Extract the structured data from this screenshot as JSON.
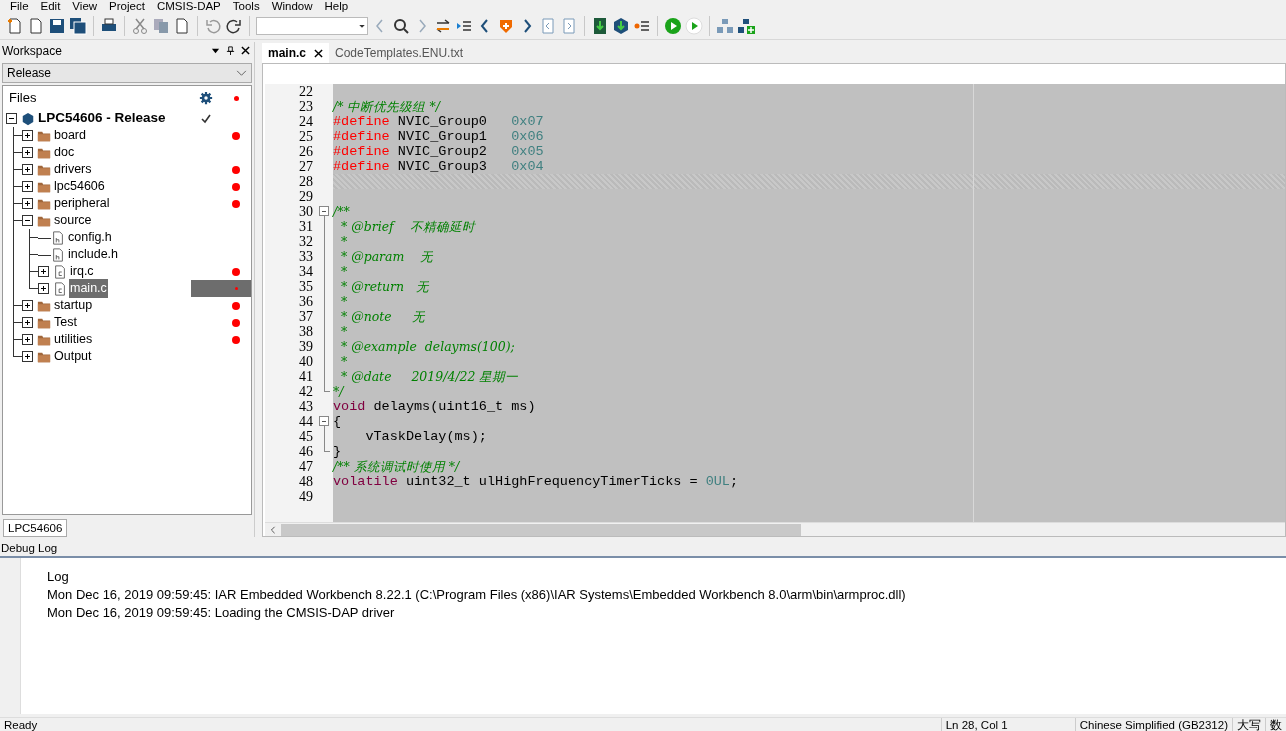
{
  "menu": [
    "File",
    "Edit",
    "View",
    "Project",
    "CMSIS-DAP",
    "Tools",
    "Window",
    "Help"
  ],
  "workspace": {
    "title": "Workspace",
    "configuration": "Release",
    "files_header": "Files",
    "tree": [
      {
        "label": "LPC54606 - Release",
        "kind": "project",
        "expanded": true,
        "checked": true,
        "error": false,
        "selected": false,
        "children": [
          {
            "label": "board",
            "kind": "folder",
            "expanded": false,
            "error": true,
            "selected": false
          },
          {
            "label": "doc",
            "kind": "folder",
            "expanded": false,
            "error": false,
            "selected": false
          },
          {
            "label": "drivers",
            "kind": "folder",
            "expanded": false,
            "error": true,
            "selected": false
          },
          {
            "label": "lpc54606",
            "kind": "folder",
            "expanded": false,
            "error": true,
            "selected": false
          },
          {
            "label": "peripheral",
            "kind": "folder",
            "expanded": false,
            "error": true,
            "selected": false
          },
          {
            "label": "source",
            "kind": "folder",
            "expanded": true,
            "error": false,
            "selected": false,
            "children": [
              {
                "label": "config.h",
                "kind": "header",
                "error": false,
                "selected": false
              },
              {
                "label": "include.h",
                "kind": "header",
                "error": false,
                "selected": false
              },
              {
                "label": "irq.c",
                "kind": "source",
                "expanded": false,
                "error": true,
                "selected": false
              },
              {
                "label": "main.c",
                "kind": "source",
                "expanded": false,
                "error": true,
                "selected": true
              }
            ]
          },
          {
            "label": "startup",
            "kind": "folder",
            "expanded": false,
            "error": true,
            "selected": false
          },
          {
            "label": "Test",
            "kind": "folder",
            "expanded": false,
            "error": true,
            "selected": false
          },
          {
            "label": "utilities",
            "kind": "folder",
            "expanded": false,
            "error": true,
            "selected": false
          },
          {
            "label": "Output",
            "kind": "folder",
            "expanded": false,
            "error": false,
            "selected": false
          }
        ]
      }
    ],
    "bottom_tab": "LPC54606"
  },
  "editor": {
    "tabs": [
      {
        "label": "main.c",
        "selected": true
      },
      {
        "label": "CodeTemplates.ENU.txt",
        "selected": false
      }
    ],
    "lines": [
      {
        "number": "22",
        "kind": "plain",
        "current": false
      },
      {
        "number": "23",
        "kind": "plain",
        "current": false,
        "tokens": [
          {
            "kind": "comment",
            "text": "/* 中断优先级组 */"
          }
        ]
      },
      {
        "number": "24",
        "kind": "plain",
        "current": false,
        "tokens": [
          {
            "kind": "directive",
            "text": "#define"
          },
          {
            "kind": "plain",
            "text": " NVIC_Group0   "
          },
          {
            "kind": "number",
            "text": "0x07"
          }
        ]
      },
      {
        "number": "25",
        "kind": "plain",
        "current": false,
        "tokens": [
          {
            "kind": "directive",
            "text": "#define"
          },
          {
            "kind": "plain",
            "text": " NVIC_Group1   "
          },
          {
            "kind": "number",
            "text": "0x06"
          }
        ]
      },
      {
        "number": "26",
        "kind": "plain",
        "current": false,
        "tokens": [
          {
            "kind": "directive",
            "text": "#define"
          },
          {
            "kind": "plain",
            "text": " NVIC_Group2   "
          },
          {
            "kind": "number",
            "text": "0x05"
          }
        ]
      },
      {
        "number": "27",
        "kind": "plain",
        "current": false,
        "tokens": [
          {
            "kind": "directive",
            "text": "#define"
          },
          {
            "kind": "plain",
            "text": " NVIC_Group3   "
          },
          {
            "kind": "number",
            "text": "0x04"
          }
        ]
      },
      {
        "number": "28",
        "kind": "plain",
        "current": true
      },
      {
        "number": "29",
        "kind": "plain",
        "current": false
      },
      {
        "number": "30",
        "kind": "foldstart",
        "current": false,
        "tokens": [
          {
            "kind": "comment",
            "text": "/**"
          }
        ]
      },
      {
        "number": "31",
        "kind": "foldbody",
        "current": false,
        "tokens": [
          {
            "kind": "comment",
            "text": "  * @brief    不精确延时"
          }
        ]
      },
      {
        "number": "32",
        "kind": "foldbody",
        "current": false,
        "tokens": [
          {
            "kind": "comment",
            "text": "  *"
          }
        ]
      },
      {
        "number": "33",
        "kind": "foldbody",
        "current": false,
        "tokens": [
          {
            "kind": "comment",
            "text": "  * @param    无"
          }
        ]
      },
      {
        "number": "34",
        "kind": "foldbody",
        "current": false,
        "tokens": [
          {
            "kind": "comment",
            "text": "  *"
          }
        ]
      },
      {
        "number": "35",
        "kind": "foldbody",
        "current": false,
        "tokens": [
          {
            "kind": "comment",
            "text": "  * @return   无"
          }
        ]
      },
      {
        "number": "36",
        "kind": "foldbody",
        "current": false,
        "tokens": [
          {
            "kind": "comment",
            "text": "  *"
          }
        ]
      },
      {
        "number": "37",
        "kind": "foldbody",
        "current": false,
        "tokens": [
          {
            "kind": "comment",
            "text": "  * @note     无"
          }
        ]
      },
      {
        "number": "38",
        "kind": "foldbody",
        "current": false,
        "tokens": [
          {
            "kind": "comment",
            "text": "  *"
          }
        ]
      },
      {
        "number": "39",
        "kind": "foldbody",
        "current": false,
        "tokens": [
          {
            "kind": "comment",
            "text": "  * @example  delayms(100);"
          }
        ]
      },
      {
        "number": "40",
        "kind": "foldbody",
        "current": false,
        "tokens": [
          {
            "kind": "comment",
            "text": "  *"
          }
        ]
      },
      {
        "number": "41",
        "kind": "foldbody",
        "current": false,
        "tokens": [
          {
            "kind": "comment",
            "text": "  * @date     2019/4/22 星期一"
          }
        ]
      },
      {
        "number": "42",
        "kind": "foldend",
        "current": false,
        "tokens": [
          {
            "kind": "comment",
            "text": "*/"
          }
        ]
      },
      {
        "number": "43",
        "kind": "plain",
        "current": false,
        "tokens": [
          {
            "kind": "keyword",
            "text": "void"
          },
          {
            "kind": "plain",
            "text": " delayms(uint16_t ms)"
          }
        ]
      },
      {
        "number": "44",
        "kind": "foldstart",
        "current": false,
        "tokens": [
          {
            "kind": "plain",
            "text": "{"
          }
        ]
      },
      {
        "number": "45",
        "kind": "foldbody",
        "current": false,
        "tokens": [
          {
            "kind": "plain",
            "text": "    vTaskDelay(ms);"
          }
        ]
      },
      {
        "number": "46",
        "kind": "foldend",
        "current": false,
        "tokens": [
          {
            "kind": "plain",
            "text": "}"
          }
        ]
      },
      {
        "number": "47",
        "kind": "plain",
        "current": false,
        "tokens": [
          {
            "kind": "comment",
            "text": "/** 系统调试时使用 */"
          }
        ]
      },
      {
        "number": "48",
        "kind": "plain",
        "current": false,
        "tokens": [
          {
            "kind": "keyword",
            "text": "volatile"
          },
          {
            "kind": "plain",
            "text": " uint32_t ulHighFrequencyTimerTicks = "
          },
          {
            "kind": "number",
            "text": "0UL"
          },
          {
            "kind": "plain",
            "text": ";"
          }
        ]
      },
      {
        "number": "49",
        "kind": "plain",
        "current": false
      }
    ]
  },
  "debug_log": {
    "title": "Debug Log",
    "header": "Log",
    "entries": [
      "Mon Dec 16, 2019 09:59:45: IAR Embedded Workbench 8.22.1 (C:\\Program Files (x86)\\IAR Systems\\Embedded Workbench 8.0\\arm\\bin\\armproc.dll)",
      "Mon Dec 16, 2019 09:59:45: Loading the CMSIS-DAP driver"
    ]
  },
  "status_bar": {
    "message": "Ready",
    "position": "Ln 28, Col 1",
    "encoding": "Chinese Simplified (GB2312)",
    "caps": "大写",
    "num": "数"
  }
}
